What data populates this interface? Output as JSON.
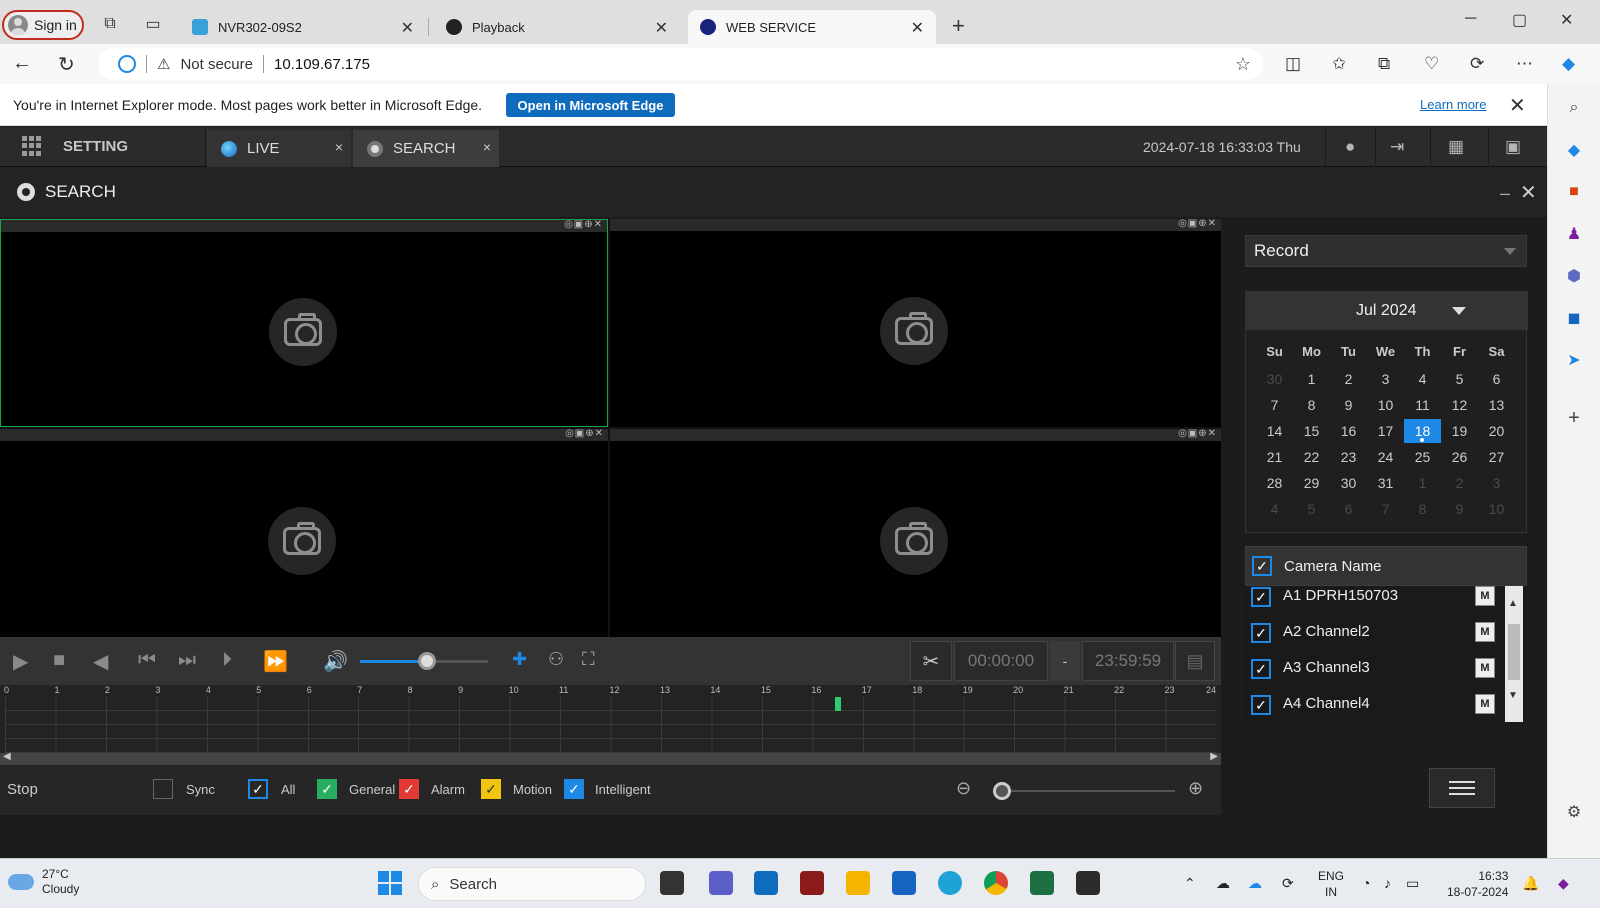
{
  "browser": {
    "signin_label": "Sign in",
    "tabs": [
      {
        "title": "NVR302-09S2",
        "active": false
      },
      {
        "title": "Playback",
        "active": false
      },
      {
        "title": "WEB SERVICE",
        "active": true
      }
    ],
    "address": {
      "security": "Not secure",
      "url": "10.109.67.175"
    },
    "ie_bar": {
      "message": "You're in Internet Explorer mode. Most pages work better in Microsoft Edge.",
      "open_button": "Open in Microsoft Edge",
      "learn_more": "Learn more"
    }
  },
  "app": {
    "setting_label": "SETTING",
    "tabs": [
      {
        "label": "LIVE",
        "close": "×"
      },
      {
        "label": "SEARCH",
        "close": "×"
      }
    ],
    "datetime": "2024-07-18 16:33:03 Thu",
    "page_title": "SEARCH",
    "pane_tools": "◎▣⊕✕",
    "controls": {
      "start_time": "00:00:00",
      "dash": "-",
      "end_time": "23:59:59"
    },
    "timeline": {
      "hours": [
        "0",
        "1",
        "2",
        "3",
        "4",
        "5",
        "6",
        "7",
        "8",
        "9",
        "10",
        "11",
        "12",
        "13",
        "14",
        "15",
        "16",
        "17",
        "18",
        "19",
        "20",
        "21",
        "22",
        "23",
        "24"
      ],
      "record_marks_hours": [
        16.5
      ]
    },
    "filters": {
      "status": "Stop",
      "items": [
        {
          "label": "Sync",
          "checked": false,
          "color": "#262626"
        },
        {
          "label": "All",
          "checked": true,
          "color": "#1e88e5"
        },
        {
          "label": "General",
          "checked": true,
          "color": "#27ae60"
        },
        {
          "label": "Alarm",
          "checked": true,
          "color": "#e53935"
        },
        {
          "label": "Motion",
          "checked": true,
          "color": "#f1c40f"
        },
        {
          "label": "Intelligent",
          "checked": true,
          "color": "#1e88e5"
        }
      ]
    },
    "right_panel": {
      "record_type": "Record",
      "calendar": {
        "month_label": "Jul 2024",
        "weekdays": [
          "Su",
          "Mo",
          "Tu",
          "We",
          "Th",
          "Fr",
          "Sa"
        ],
        "days": [
          [
            "30",
            "1",
            "2",
            "3",
            "4",
            "5",
            "6"
          ],
          [
            "7",
            "8",
            "9",
            "10",
            "11",
            "12",
            "13"
          ],
          [
            "14",
            "15",
            "16",
            "17",
            "18",
            "19",
            "20"
          ],
          [
            "21",
            "22",
            "23",
            "24",
            "25",
            "26",
            "27"
          ],
          [
            "28",
            "29",
            "30",
            "31",
            "1",
            "2",
            "3"
          ],
          [
            "4",
            "5",
            "6",
            "7",
            "8",
            "9",
            "10"
          ]
        ],
        "selected_day": "18"
      },
      "camera_header": "Camera Name",
      "cameras": [
        {
          "name": "A1 DPRH150703",
          "mode": "M"
        },
        {
          "name": "A2 Channel2",
          "mode": "M"
        },
        {
          "name": "A3 Channel3",
          "mode": "M"
        },
        {
          "name": "A4 Channel4",
          "mode": "M"
        }
      ]
    }
  },
  "taskbar": {
    "weather_temp": "27°C",
    "weather_desc": "Cloudy",
    "search_label": "Search",
    "lang_top": "ENG",
    "lang_bottom": "IN",
    "time": "16:33",
    "date": "18-07-2024"
  },
  "colors": {
    "accent": "#1e88e5",
    "edge_button": "#0f6cbd",
    "app_bg": "#1c1c1c",
    "record_mark": "#2ecc71"
  }
}
